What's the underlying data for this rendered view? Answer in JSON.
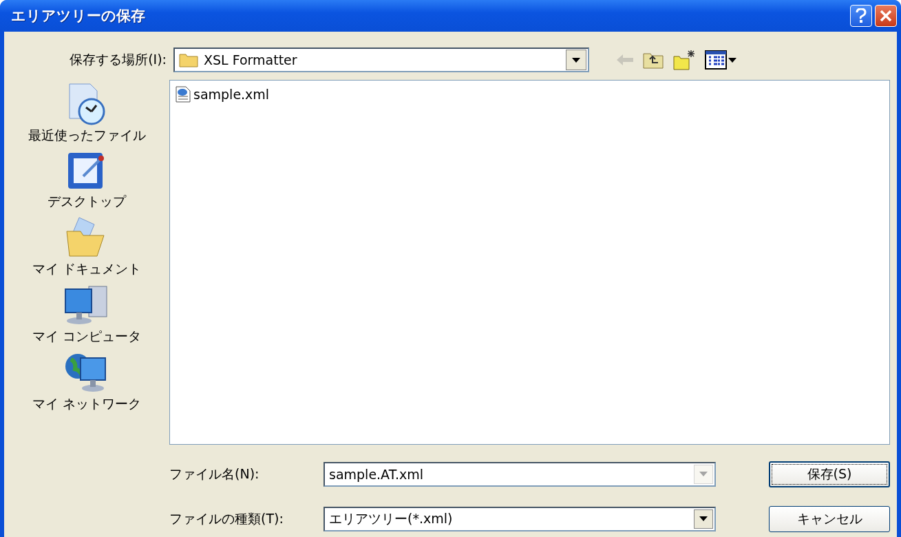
{
  "window": {
    "title": "エリアツリーの保存"
  },
  "location": {
    "label": "保存する場所(I):",
    "value": "XSL Formatter"
  },
  "toolbar": [
    {
      "kind": "back",
      "disabled": true
    },
    {
      "kind": "up",
      "disabled": false
    },
    {
      "kind": "newfolder",
      "disabled": false
    },
    {
      "kind": "views",
      "disabled": false
    }
  ],
  "places": [
    {
      "kind": "recent",
      "label": "最近使ったファイル"
    },
    {
      "kind": "desktop",
      "label": "デスクトップ"
    },
    {
      "kind": "documents",
      "label": "マイ ドキュメント"
    },
    {
      "kind": "computer",
      "label": "マイ コンピュータ"
    },
    {
      "kind": "network",
      "label": "マイ ネットワーク"
    }
  ],
  "files": [
    {
      "name": "sample.xml",
      "selected": false
    }
  ],
  "filename": {
    "label": "ファイル名(N):",
    "value": "sample.AT.xml",
    "dropdown_disabled": true
  },
  "filetype": {
    "label": "ファイルの種類(T):",
    "value": "エリアツリー(*.xml)",
    "dropdown_disabled": false
  },
  "buttons": [
    {
      "label": "保存(S)",
      "default": true
    },
    {
      "label": "キャンセル",
      "default": false
    }
  ]
}
